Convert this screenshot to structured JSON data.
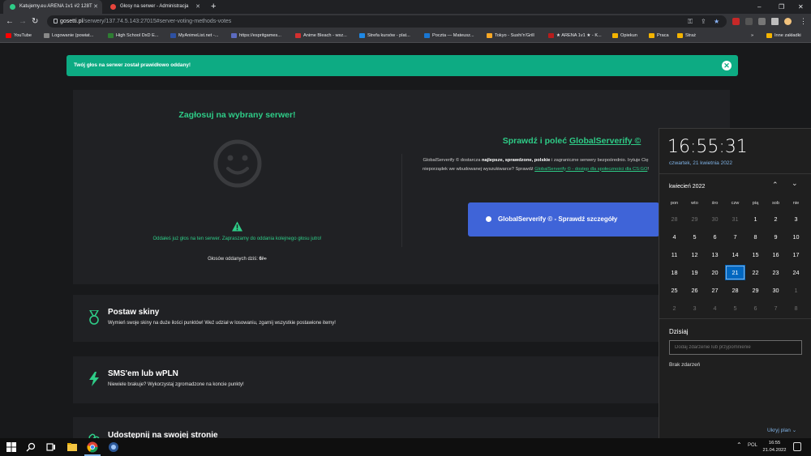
{
  "browser": {
    "tabs": [
      {
        "title": "Katujemy.eu ARENA 1v1 #2 128T",
        "active": true,
        "favicon_color": "#2ecc87"
      },
      {
        "title": "Głosy na serwer - Administracja",
        "active": false,
        "favicon_color": "#e8453c"
      }
    ],
    "new_tab": "+",
    "window_controls": {
      "minimize": "–",
      "maximize": "❐",
      "close": "✕"
    },
    "url_domain": "gosetti.pl",
    "url_path": "/serwery/137.74.5.143:27015#server-voting-methods-votes",
    "bookmarks": [
      {
        "label": "YouTube",
        "color": "#ff0000"
      },
      {
        "label": "Logowanie (powiat...",
        "color": "#888888"
      },
      {
        "label": "High School DxD E...",
        "color": "#2e7d32"
      },
      {
        "label": "MyAnimeList.net -...",
        "color": "#2e51a2"
      },
      {
        "label": "https://espritgames...",
        "color": "#5c6bc0"
      },
      {
        "label": "Anime Bleach - wsz...",
        "color": "#d32f2f"
      },
      {
        "label": "Strefa kursów - plat...",
        "color": "#1e88e5"
      },
      {
        "label": "Poczta — Mateusz...",
        "color": "#1976d2"
      },
      {
        "label": "Tokyo - Sushi'n'Grill",
        "color": "#f9a825"
      },
      {
        "label": "★ ARENA 1v1 ★ - K...",
        "color": "#b71c1c"
      },
      {
        "label": "Opiekun",
        "color": "#f4b400"
      },
      {
        "label": "Praca",
        "color": "#f4b400"
      },
      {
        "label": "Straż",
        "color": "#f4b400"
      }
    ],
    "bookmarks_more": "»",
    "other_bookmarks": "Inne zakładki"
  },
  "alert": {
    "text": "Twój głos na serwer został prawidłowo oddany!",
    "close": "✕"
  },
  "vote": {
    "title": "Zagłosuj na wybrany serwer!",
    "message": "Oddałeś już głos na ten serwer. Zapraszamy do oddania kolejnego głosu jutro!",
    "count_label": "Głosów oddanych dziś:",
    "count_value": "6/∞"
  },
  "globalserverify": {
    "title_prefix": "Sprawdź i poleć",
    "title_link": "GlobalServerify ©",
    "desc_1": "GlobalServerify © dostarcza",
    "desc_bold": "najlepsze, sprawdzone, polskie",
    "desc_2": "i zagraniczne serwery bezpośrednio. Irytuje Cię nieporządek we wbudowanej wyszukiwarce? Sprawdź",
    "desc_link": "GlobalServerify © - dostęp dla społeczności dla CS:GO",
    "desc_3": "!",
    "button_label": "GlobalServerify © - Sprawdź szczegóły"
  },
  "features": [
    {
      "title": "Postaw skiny",
      "desc": "Wymień swoje skiny na duże ilości punktów! Weź udział w losowaniu, zgarnij wszystkie postawione itemy!",
      "icon": "medal-icon"
    },
    {
      "title": "SMS'em lub wPLN",
      "desc": "Niewiele brakuje? Wykorzystaj zgromadzone na koncie punkty!",
      "icon": "lightning-icon"
    },
    {
      "title": "Udostępnij na swojej stronie",
      "desc": "",
      "icon": "link-icon"
    }
  ],
  "calendar": {
    "time": "16:55:31",
    "date_long": "czwartek, 21 kwietnia 2022",
    "month": "kwiecień 2022",
    "weekdays": [
      "pon",
      "wto",
      "śro",
      "czw",
      "pią",
      "sob",
      "nie"
    ],
    "weeks": [
      [
        "28",
        "29",
        "30",
        "31",
        "1",
        "2",
        "3"
      ],
      [
        "4",
        "5",
        "6",
        "7",
        "8",
        "9",
        "10"
      ],
      [
        "11",
        "12",
        "13",
        "14",
        "15",
        "16",
        "17"
      ],
      [
        "18",
        "19",
        "20",
        "21",
        "22",
        "23",
        "24"
      ],
      [
        "25",
        "26",
        "27",
        "28",
        "29",
        "30",
        "1"
      ],
      [
        "2",
        "3",
        "4",
        "5",
        "6",
        "7",
        "8"
      ]
    ],
    "today": "21",
    "today_label": "Dzisiaj",
    "event_placeholder": "Dodaj zdarzenie lub przypomnienie",
    "no_events": "Brak zdarzeń",
    "hide_plan": "Ukryj plan"
  },
  "taskbar": {
    "language": "POL",
    "time": "16:55",
    "date": "21.04.2022"
  },
  "colors": {
    "accent_green": "#2ecc87",
    "alert_green": "#0dab83",
    "button_blue": "#3f64d8",
    "windows_blue": "#0067c0"
  }
}
